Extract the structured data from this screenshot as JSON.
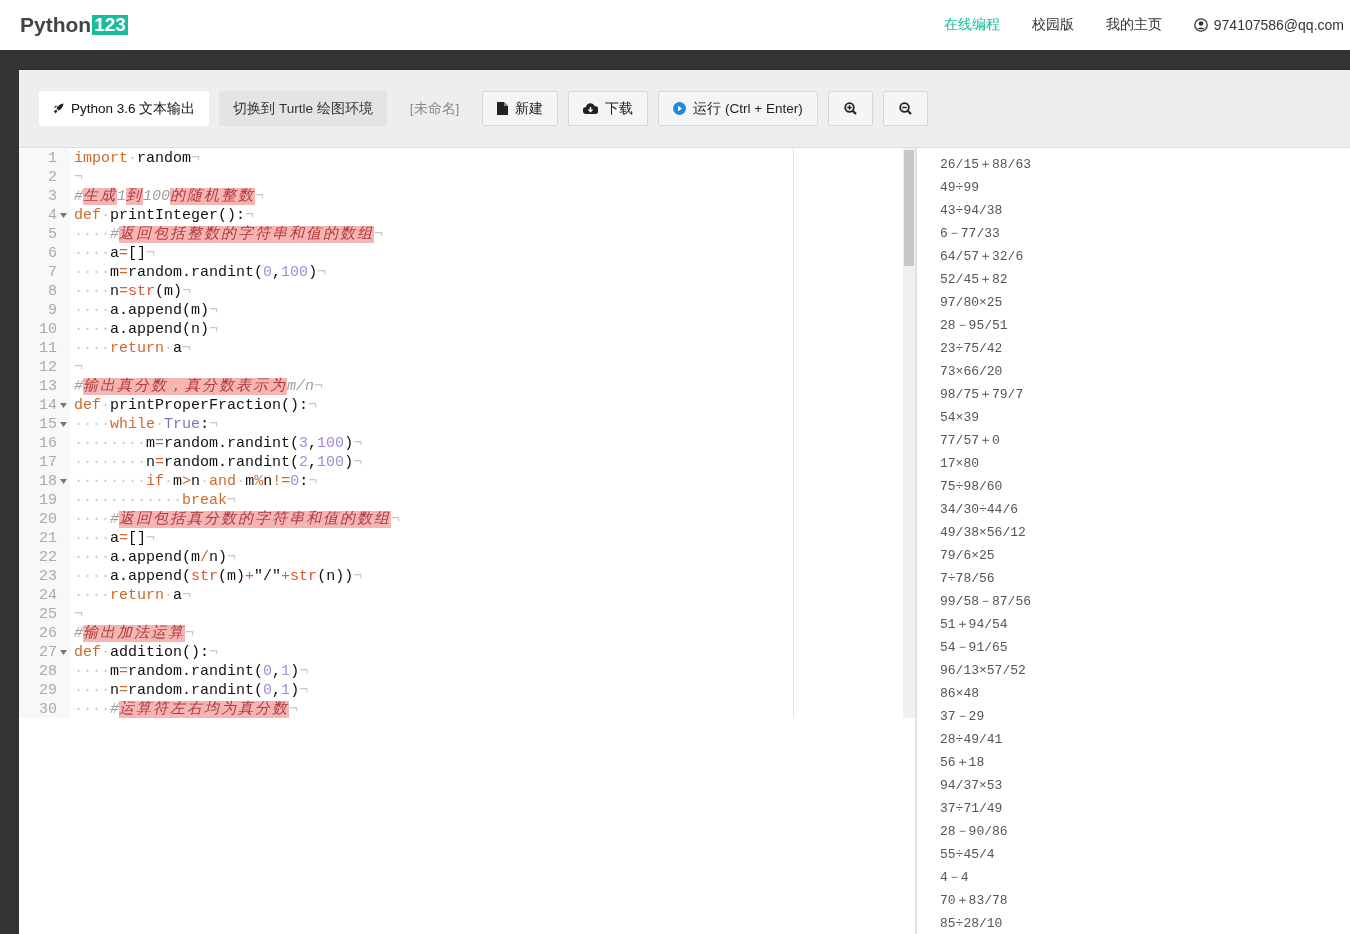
{
  "header": {
    "logo": {
      "text": "Python",
      "badge": "123"
    },
    "nav": [
      {
        "label": "在线编程",
        "selected": true
      },
      {
        "label": "校园版",
        "selected": false
      },
      {
        "label": "我的主页",
        "selected": false
      }
    ],
    "user": "974107586@qq.com"
  },
  "toolbar": {
    "modes": [
      {
        "label": "Python 3.6 文本输出",
        "selected": true
      },
      {
        "label": "切换到 Turtle 绘图环境",
        "selected": false
      }
    ],
    "filename": "[未命名]",
    "buttons": [
      {
        "kind": "new",
        "label": "新建"
      },
      {
        "kind": "download",
        "label": "下载"
      },
      {
        "kind": "run",
        "label": "运行 (Ctrl + Enter)"
      },
      {
        "kind": "zoom-in"
      },
      {
        "kind": "zoom-out"
      }
    ]
  },
  "editor": {
    "lines": [
      {
        "number": "1",
        "foldable": false,
        "tokens": [
          {
            "kind": "kw",
            "text": "import"
          },
          {
            "kind": "ws",
            "text": "·"
          },
          {
            "kind": "plain",
            "text": "random"
          },
          {
            "kind": "ws",
            "text": "¬"
          }
        ]
      },
      {
        "number": "2",
        "foldable": false,
        "tokens": [
          {
            "kind": "ws",
            "text": "¬"
          }
        ]
      },
      {
        "number": "3",
        "foldable": false,
        "tokens": [
          {
            "kind": "comment",
            "text": "#"
          },
          {
            "kind": "error",
            "text": "生成"
          },
          {
            "kind": "comment",
            "text": "1"
          },
          {
            "kind": "error",
            "text": "到"
          },
          {
            "kind": "comment",
            "text": "100"
          },
          {
            "kind": "error",
            "text": "的随机整数"
          },
          {
            "kind": "ws",
            "text": "¬"
          }
        ]
      },
      {
        "number": "4",
        "foldable": true,
        "tokens": [
          {
            "kind": "kw",
            "text": "def"
          },
          {
            "kind": "ws",
            "text": "·"
          },
          {
            "kind": "plain",
            "text": "printInteger():"
          },
          {
            "kind": "ws",
            "text": "¬"
          }
        ]
      },
      {
        "number": "5",
        "foldable": false,
        "tokens": [
          {
            "kind": "ws",
            "text": "····"
          },
          {
            "kind": "comment",
            "text": "#"
          },
          {
            "kind": "error",
            "text": "返回包括整数的字符串和值的数组"
          },
          {
            "kind": "ws",
            "text": "¬"
          }
        ]
      },
      {
        "number": "6",
        "foldable": false,
        "tokens": [
          {
            "kind": "ws",
            "text": "····"
          },
          {
            "kind": "plain",
            "text": "a"
          },
          {
            "kind": "op",
            "text": "="
          },
          {
            "kind": "plain",
            "text": "[]"
          },
          {
            "kind": "ws",
            "text": "¬"
          }
        ]
      },
      {
        "number": "7",
        "foldable": false,
        "tokens": [
          {
            "kind": "ws",
            "text": "····"
          },
          {
            "kind": "plain",
            "text": "m"
          },
          {
            "kind": "op",
            "text": "="
          },
          {
            "kind": "plain",
            "text": "random.randint("
          },
          {
            "kind": "num",
            "text": "0"
          },
          {
            "kind": "plain",
            "text": ","
          },
          {
            "kind": "num",
            "text": "100"
          },
          {
            "kind": "plain",
            "text": ")"
          },
          {
            "kind": "ws",
            "text": "¬"
          }
        ]
      },
      {
        "number": "8",
        "foldable": false,
        "tokens": [
          {
            "kind": "ws",
            "text": "····"
          },
          {
            "kind": "plain",
            "text": "n"
          },
          {
            "kind": "op",
            "text": "="
          },
          {
            "kind": "builtin",
            "text": "str"
          },
          {
            "kind": "plain",
            "text": "(m)"
          },
          {
            "kind": "ws",
            "text": "¬"
          }
        ]
      },
      {
        "number": "9",
        "foldable": false,
        "tokens": [
          {
            "kind": "ws",
            "text": "····"
          },
          {
            "kind": "plain",
            "text": "a.append(m)"
          },
          {
            "kind": "ws",
            "text": "¬"
          }
        ]
      },
      {
        "number": "10",
        "foldable": false,
        "tokens": [
          {
            "kind": "ws",
            "text": "····"
          },
          {
            "kind": "plain",
            "text": "a.append(n)"
          },
          {
            "kind": "ws",
            "text": "¬"
          }
        ]
      },
      {
        "number": "11",
        "foldable": false,
        "tokens": [
          {
            "kind": "ws",
            "text": "····"
          },
          {
            "kind": "kw",
            "text": "return"
          },
          {
            "kind": "ws",
            "text": "·"
          },
          {
            "kind": "plain",
            "text": "a"
          },
          {
            "kind": "ws",
            "text": "¬"
          }
        ]
      },
      {
        "number": "12",
        "foldable": false,
        "tokens": [
          {
            "kind": "ws",
            "text": "¬"
          }
        ]
      },
      {
        "number": "13",
        "foldable": false,
        "tokens": [
          {
            "kind": "comment",
            "text": "#"
          },
          {
            "kind": "error",
            "text": "输出真分数，真分数表示为"
          },
          {
            "kind": "comment",
            "text": "m/n"
          },
          {
            "kind": "ws",
            "text": "¬"
          }
        ]
      },
      {
        "number": "14",
        "foldable": true,
        "tokens": [
          {
            "kind": "kw",
            "text": "def"
          },
          {
            "kind": "ws",
            "text": "·"
          },
          {
            "kind": "plain",
            "text": "printProperFraction():"
          },
          {
            "kind": "ws",
            "text": "¬"
          }
        ]
      },
      {
        "number": "15",
        "foldable": true,
        "tokens": [
          {
            "kind": "ws",
            "text": "····"
          },
          {
            "kind": "kw",
            "text": "while"
          },
          {
            "kind": "ws",
            "text": "·"
          },
          {
            "kind": "const",
            "text": "True"
          },
          {
            "kind": "plain",
            "text": ":"
          },
          {
            "kind": "ws",
            "text": "¬"
          }
        ]
      },
      {
        "number": "16",
        "foldable": false,
        "tokens": [
          {
            "kind": "ws",
            "text": "········"
          },
          {
            "kind": "plain",
            "text": "m"
          },
          {
            "kind": "op",
            "text": "="
          },
          {
            "kind": "plain",
            "text": "random.randint("
          },
          {
            "kind": "num",
            "text": "3"
          },
          {
            "kind": "plain",
            "text": ","
          },
          {
            "kind": "num",
            "text": "100"
          },
          {
            "kind": "plain",
            "text": ")"
          },
          {
            "kind": "ws",
            "text": "¬"
          }
        ]
      },
      {
        "number": "17",
        "foldable": false,
        "tokens": [
          {
            "kind": "ws",
            "text": "········"
          },
          {
            "kind": "plain",
            "text": "n"
          },
          {
            "kind": "op",
            "text": "="
          },
          {
            "kind": "plain",
            "text": "random.randint("
          },
          {
            "kind": "num",
            "text": "2"
          },
          {
            "kind": "plain",
            "text": ","
          },
          {
            "kind": "num",
            "text": "100"
          },
          {
            "kind": "plain",
            "text": ")"
          },
          {
            "kind": "ws",
            "text": "¬"
          }
        ]
      },
      {
        "number": "18",
        "foldable": true,
        "tokens": [
          {
            "kind": "ws",
            "text": "········"
          },
          {
            "kind": "kw",
            "text": "if"
          },
          {
            "kind": "ws",
            "text": "·"
          },
          {
            "kind": "plain",
            "text": "m"
          },
          {
            "kind": "op",
            "text": ">"
          },
          {
            "kind": "plain",
            "text": "n"
          },
          {
            "kind": "ws",
            "text": "·"
          },
          {
            "kind": "kw",
            "text": "and"
          },
          {
            "kind": "ws",
            "text": "·"
          },
          {
            "kind": "plain",
            "text": "m"
          },
          {
            "kind": "op",
            "text": "%"
          },
          {
            "kind": "plain",
            "text": "n"
          },
          {
            "kind": "op",
            "text": "!="
          },
          {
            "kind": "num",
            "text": "0"
          },
          {
            "kind": "plain",
            "text": ":"
          },
          {
            "kind": "ws",
            "text": "¬"
          }
        ]
      },
      {
        "number": "19",
        "foldable": false,
        "tokens": [
          {
            "kind": "ws",
            "text": "············"
          },
          {
            "kind": "kw",
            "text": "break"
          },
          {
            "kind": "ws",
            "text": "¬"
          }
        ]
      },
      {
        "number": "20",
        "foldable": false,
        "tokens": [
          {
            "kind": "ws",
            "text": "····"
          },
          {
            "kind": "comment",
            "text": "#"
          },
          {
            "kind": "error",
            "text": "返回包括真分数的字符串和值的数组"
          },
          {
            "kind": "ws",
            "text": "¬"
          }
        ]
      },
      {
        "number": "21",
        "foldable": false,
        "tokens": [
          {
            "kind": "ws",
            "text": "····"
          },
          {
            "kind": "plain",
            "text": "a"
          },
          {
            "kind": "op",
            "text": "="
          },
          {
            "kind": "plain",
            "text": "[]"
          },
          {
            "kind": "ws",
            "text": "¬"
          }
        ]
      },
      {
        "number": "22",
        "foldable": false,
        "tokens": [
          {
            "kind": "ws",
            "text": "····"
          },
          {
            "kind": "plain",
            "text": "a.append(m"
          },
          {
            "kind": "op",
            "text": "/"
          },
          {
            "kind": "plain",
            "text": "n)"
          },
          {
            "kind": "ws",
            "text": "¬"
          }
        ]
      },
      {
        "number": "23",
        "foldable": false,
        "tokens": [
          {
            "kind": "ws",
            "text": "····"
          },
          {
            "kind": "plain",
            "text": "a.append("
          },
          {
            "kind": "builtin",
            "text": "str"
          },
          {
            "kind": "plain",
            "text": "(m)"
          },
          {
            "kind": "op",
            "text": "+"
          },
          {
            "kind": "plain",
            "text": "\"/\""
          },
          {
            "kind": "op",
            "text": "+"
          },
          {
            "kind": "builtin",
            "text": "str"
          },
          {
            "kind": "plain",
            "text": "(n))"
          },
          {
            "kind": "ws",
            "text": "¬"
          }
        ]
      },
      {
        "number": "24",
        "foldable": false,
        "tokens": [
          {
            "kind": "ws",
            "text": "····"
          },
          {
            "kind": "kw",
            "text": "return"
          },
          {
            "kind": "ws",
            "text": "·"
          },
          {
            "kind": "plain",
            "text": "a"
          },
          {
            "kind": "ws",
            "text": "¬"
          }
        ]
      },
      {
        "number": "25",
        "foldable": false,
        "tokens": [
          {
            "kind": "ws",
            "text": "¬"
          }
        ]
      },
      {
        "number": "26",
        "foldable": false,
        "tokens": [
          {
            "kind": "comment",
            "text": "#"
          },
          {
            "kind": "error",
            "text": "输出加法运算"
          },
          {
            "kind": "ws",
            "text": "¬"
          }
        ]
      },
      {
        "number": "27",
        "foldable": true,
        "tokens": [
          {
            "kind": "kw",
            "text": "def"
          },
          {
            "kind": "ws",
            "text": "·"
          },
          {
            "kind": "plain",
            "text": "addition():"
          },
          {
            "kind": "ws",
            "text": "¬"
          }
        ]
      },
      {
        "number": "28",
        "foldable": false,
        "tokens": [
          {
            "kind": "ws",
            "text": "····"
          },
          {
            "kind": "plain",
            "text": "m"
          },
          {
            "kind": "op",
            "text": "="
          },
          {
            "kind": "plain",
            "text": "random.randint("
          },
          {
            "kind": "num",
            "text": "0"
          },
          {
            "kind": "plain",
            "text": ","
          },
          {
            "kind": "num",
            "text": "1"
          },
          {
            "kind": "plain",
            "text": ")"
          },
          {
            "kind": "ws",
            "text": "¬"
          }
        ]
      },
      {
        "number": "29",
        "foldable": false,
        "tokens": [
          {
            "kind": "ws",
            "text": "····"
          },
          {
            "kind": "plain",
            "text": "n"
          },
          {
            "kind": "op",
            "text": "="
          },
          {
            "kind": "plain",
            "text": "random.randint("
          },
          {
            "kind": "num",
            "text": "0"
          },
          {
            "kind": "plain",
            "text": ","
          },
          {
            "kind": "num",
            "text": "1"
          },
          {
            "kind": "plain",
            "text": ")"
          },
          {
            "kind": "ws",
            "text": "¬"
          }
        ]
      },
      {
        "number": "30",
        "foldable": false,
        "tokens": [
          {
            "kind": "ws",
            "text": "····"
          },
          {
            "kind": "comment",
            "text": "#"
          },
          {
            "kind": "error",
            "text": "运算符左右均为真分数"
          },
          {
            "kind": "ws",
            "text": "¬"
          }
        ]
      }
    ]
  },
  "output": {
    "lines": [
      "26/15＋88/63",
      "49÷99",
      "43÷94/38",
      "6－77/33",
      "64/57＋32/6",
      "52/45＋82",
      "97/80×25",
      "28－95/51",
      "23÷75/42",
      "73×66/20",
      "98/75＋79/7",
      "54×39",
      "77/57＋0",
      "17×80",
      "75÷98/60",
      "34/30÷44/6",
      "49/38×56/12",
      "79/6×25",
      "7÷78/56",
      "99/58－87/56",
      "51＋94/54",
      "54－91/65",
      "96/13×57/52",
      "86×48",
      "37－29",
      "28÷49/41",
      "56＋18",
      "94/37×53",
      "37÷71/49",
      "28－90/86",
      "55÷45/4",
      "4－4",
      "70＋83/78",
      "85÷28/10"
    ]
  }
}
